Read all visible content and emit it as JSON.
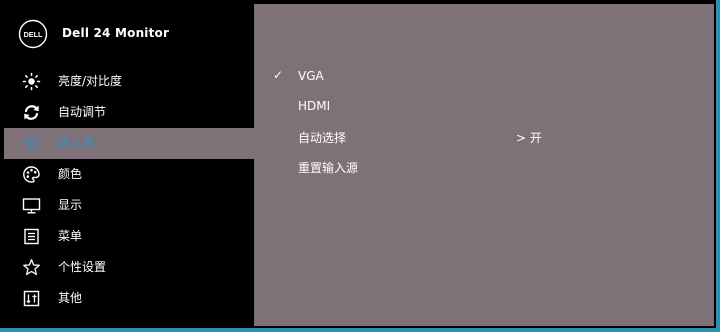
{
  "brand": {
    "logo_text": "DELL",
    "monitor_name": "Dell 24 Monitor"
  },
  "menu": [
    {
      "label": "亮度/对比度",
      "icon": "brightness-icon",
      "active": false
    },
    {
      "label": "自动调节",
      "icon": "auto-adjust-icon",
      "active": false
    },
    {
      "label": "输入源",
      "icon": "input-source-icon",
      "active": true
    },
    {
      "label": "颜色",
      "icon": "color-palette-icon",
      "active": false
    },
    {
      "label": "显示",
      "icon": "display-icon",
      "active": false
    },
    {
      "label": "菜单",
      "icon": "menu-icon",
      "active": false
    },
    {
      "label": "个性设置",
      "icon": "star-icon",
      "active": false
    },
    {
      "label": "其他",
      "icon": "other-icon",
      "active": false
    }
  ],
  "options": [
    {
      "label": "VGA",
      "checked": true,
      "value": ""
    },
    {
      "label": "HDMI",
      "checked": false,
      "value": ""
    },
    {
      "label": "自动选择",
      "checked": false,
      "value": "> 开"
    },
    {
      "label": "重置输入源",
      "checked": false,
      "value": ""
    }
  ],
  "check_mark": "✓",
  "colors": {
    "sidebar_bg": "#000000",
    "content_bg": "#7e7278",
    "active_text": "#3a8fc0",
    "frame_border": "#2d8fb5"
  }
}
